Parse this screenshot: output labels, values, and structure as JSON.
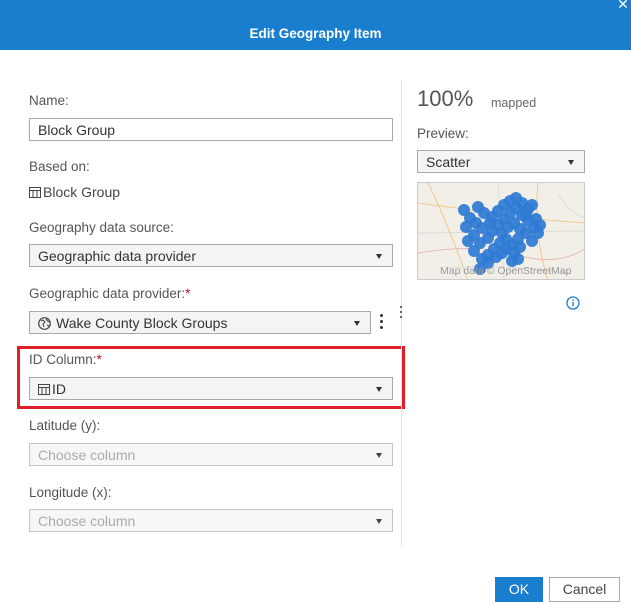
{
  "dialog": {
    "title": "Edit Geography Item",
    "close_icon": "close-icon"
  },
  "form": {
    "name_label": "Name:",
    "name_value": "Block Group",
    "based_on_label": "Based on:",
    "based_on_value": "Block Group",
    "data_source_label": "Geography data source:",
    "data_source_value": "Geographic data provider",
    "provider_label": "Geographic data provider:",
    "provider_value": "Wake County Block Groups",
    "id_column_label": "ID Column:",
    "id_column_value": "ID",
    "latitude_label": "Latitude (y):",
    "latitude_placeholder": "Choose column",
    "longitude_label": "Longitude (x):",
    "longitude_placeholder": "Choose column",
    "required_mark": "*"
  },
  "preview": {
    "mapped_percent": "100%",
    "mapped_label": "mapped",
    "preview_label": "Preview:",
    "preview_type": "Scatter",
    "map_attribution": "Map data © OpenStreetMap"
  },
  "buttons": {
    "ok": "OK",
    "cancel": "Cancel"
  },
  "colors": {
    "accent": "#1a7ecf",
    "highlight": "#e01f2a",
    "required": "#d0021b",
    "points": "#2f7bd4"
  }
}
